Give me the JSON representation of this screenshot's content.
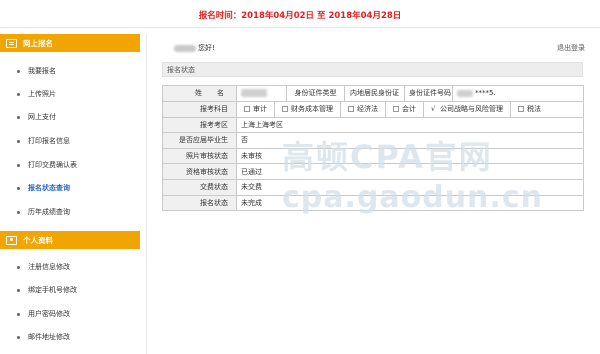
{
  "header": {
    "registration_period": "报名时间：2018年04月02日 至 2018年04月28日"
  },
  "sidebar": {
    "sections": [
      {
        "title": "网上报名",
        "icon": "monitor-icon"
      },
      {
        "title": "个人资料",
        "icon": "person-icon"
      }
    ],
    "online_items": [
      {
        "label": "我要报名"
      },
      {
        "label": "上传照片"
      },
      {
        "label": "网上支付"
      },
      {
        "label": "打印报名信息"
      },
      {
        "label": "打印交费确认表"
      },
      {
        "label": "报名状态查询",
        "active": true
      },
      {
        "label": "历年成绩查询"
      }
    ],
    "profile_items": [
      {
        "label": "注册信息修改"
      },
      {
        "label": "绑定手机号修改"
      },
      {
        "label": "用户密码修改"
      },
      {
        "label": "邮件地址修改"
      }
    ]
  },
  "main": {
    "greeting": "您好!",
    "logout": "退出登录",
    "panel_title": "报名状态",
    "table": {
      "name_label": "姓　名",
      "id_type_label": "身份证件类型",
      "id_type_value": "内地居民身份证",
      "id_number_label": "身份证件号码",
      "id_number_value": "****5.",
      "subjects_label": "报考科目",
      "subjects": [
        {
          "label": "审计",
          "checked": false
        },
        {
          "label": "财务成本管理",
          "checked": false
        },
        {
          "label": "经济法",
          "checked": false
        },
        {
          "label": "会计",
          "checked": false
        },
        {
          "label": "公司战略与风险管理",
          "checked": true,
          "mark": "√"
        },
        {
          "label": "税法",
          "checked": false
        }
      ],
      "rows": [
        {
          "label": "报考考区",
          "value": "上海上海考区"
        },
        {
          "label": "是否应届毕业生",
          "value": "否"
        },
        {
          "label": "照片审核状态",
          "value": "未审核"
        },
        {
          "label": "资格审核状态",
          "value": "已通过"
        },
        {
          "label": "交费状态",
          "value": "未交费"
        },
        {
          "label": "报名状态",
          "value": "未完成"
        }
      ]
    }
  },
  "watermark": {
    "line1": "高顿CPA官网",
    "line2": "cpa.gaodun.cn"
  },
  "colors": {
    "header_red": "#e02020",
    "sidebar_orange": "#f2a400",
    "active_blue": "#2a65c4"
  }
}
